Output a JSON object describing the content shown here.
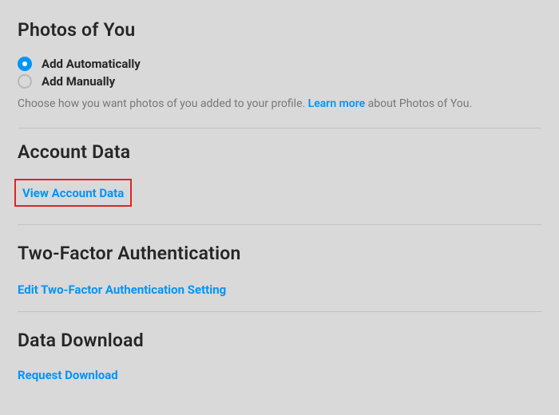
{
  "photos": {
    "heading": "Photos of You",
    "options": [
      {
        "label": "Add Automatically",
        "checked": true
      },
      {
        "label": "Add Manually",
        "checked": false
      }
    ],
    "help_pre": "Choose how you want photos of you added to your profile. ",
    "help_link": "Learn more",
    "help_post": " about Photos of You."
  },
  "account_data": {
    "heading": "Account Data",
    "link": "View Account Data"
  },
  "two_factor": {
    "heading": "Two-Factor Authentication",
    "link": "Edit Two-Factor Authentication Setting"
  },
  "data_download": {
    "heading": "Data Download",
    "link": "Request Download"
  }
}
